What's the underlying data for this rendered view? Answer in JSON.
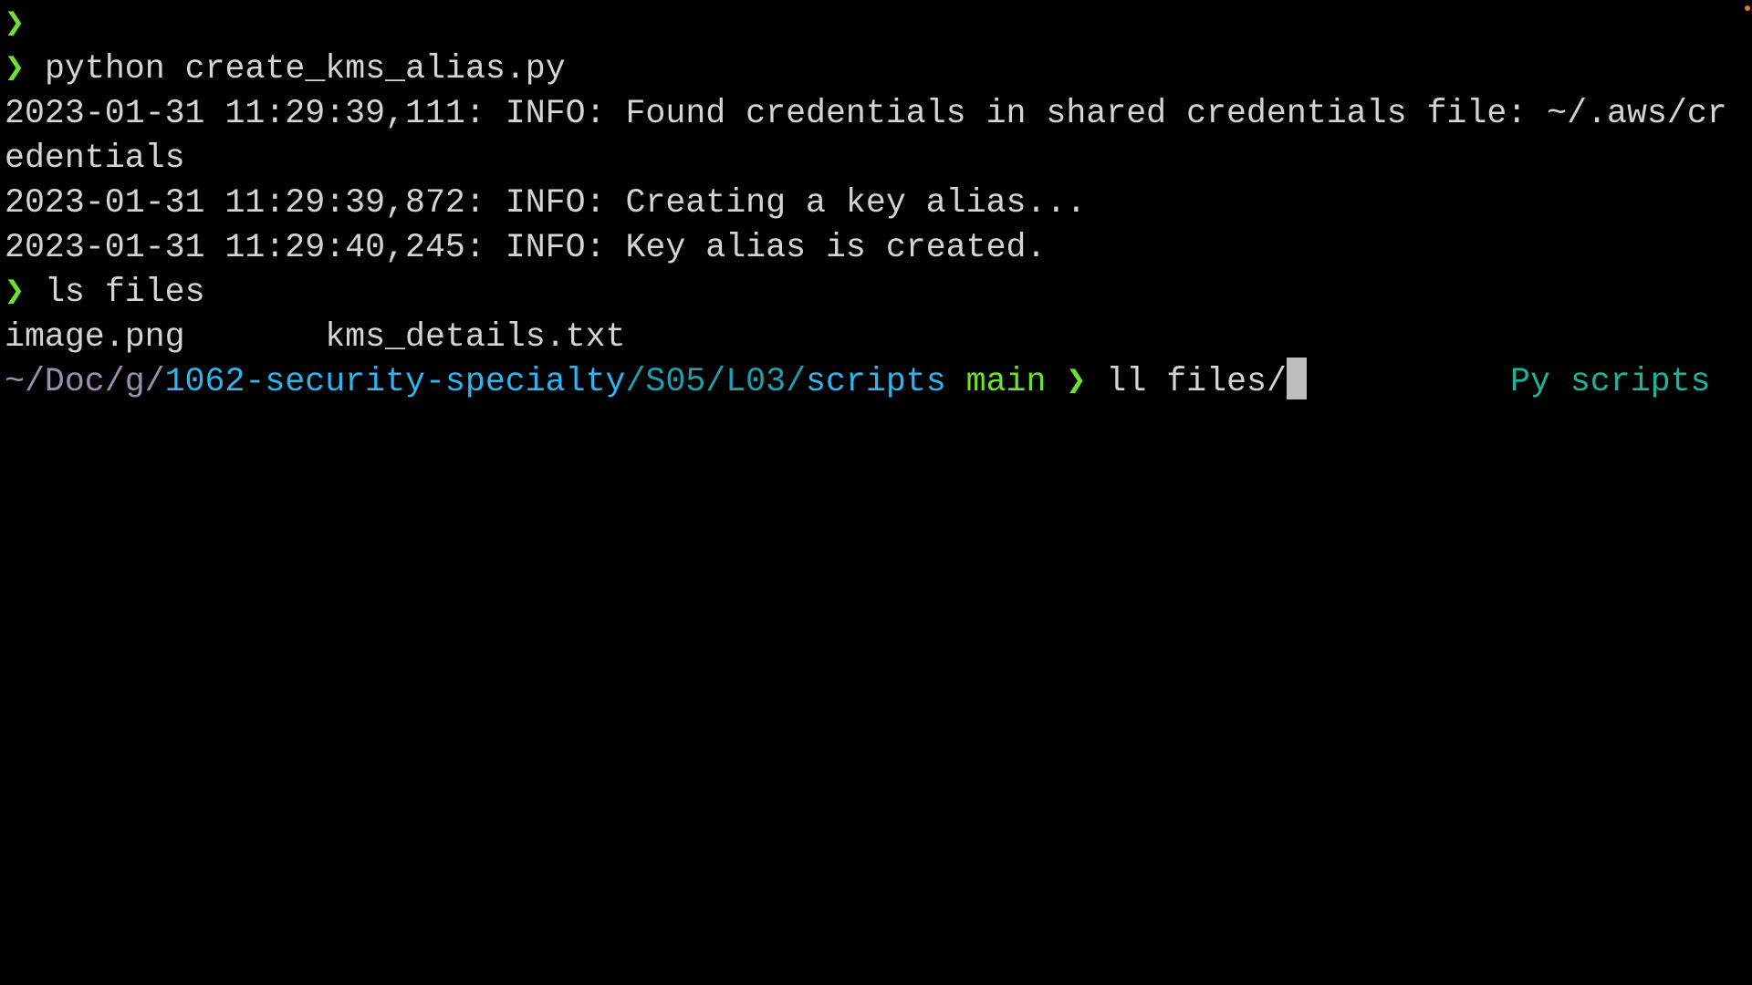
{
  "prompt_symbol": "❯",
  "lines": {
    "cmd1": "python create_kms_alias.py",
    "out1": "2023-01-31 11:29:39,111: INFO: Found credentials in shared credentials file: ~/.aws/cr",
    "out1_wrap": "edentials",
    "out2": "2023-01-31 11:29:39,872: INFO: Creating a key alias...",
    "out3": "2023-01-31 11:29:40,245: INFO: Key alias is created.",
    "cmd2": "ls files",
    "ls_file1": "image.png",
    "ls_file2": "kms_details.txt"
  },
  "current_prompt": {
    "path_dim": "~/Doc/g/",
    "path_repo": "1062-security-specialty",
    "path_mid": "/S05/L03/",
    "path_dir": "scripts",
    "branch": "main",
    "input": "ll files/",
    "right_prompt": "Py scripts"
  }
}
